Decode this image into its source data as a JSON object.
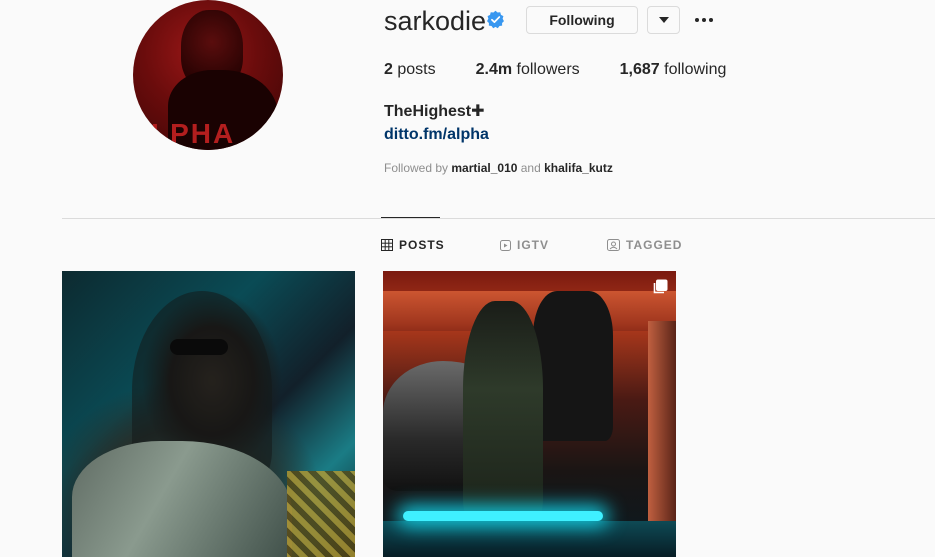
{
  "profile": {
    "username": "sarkodie",
    "verified": true,
    "avatar_text": "LPHA",
    "following_button": "Following",
    "dropdown_icon": "chevron-down-icon",
    "more_icon": "ellipsis-icon",
    "stats": {
      "posts_count": "2",
      "posts_label": " posts",
      "followers_count": "2.4m",
      "followers_label": " followers",
      "following_count": "1,687",
      "following_label": " following"
    },
    "full_name": "TheHighest✚",
    "link": "ditto.fm/alpha",
    "followed_by": {
      "prefix": "Followed by ",
      "user1": "martial_010",
      "joiner": " and ",
      "user2": "khalifa_kutz"
    }
  },
  "tabs": [
    {
      "label": "POSTS",
      "icon": "grid-icon",
      "active": true
    },
    {
      "label": "IGTV",
      "icon": "igtv-icon",
      "active": false
    },
    {
      "label": "TAGGED",
      "icon": "tagged-icon",
      "active": false
    }
  ],
  "posts": [
    {
      "type": "photo"
    },
    {
      "type": "carousel",
      "badge_icon": "multiple-photos-icon"
    }
  ],
  "colors": {
    "background": "#fafafa",
    "text": "#262626",
    "muted": "#8e8e8e",
    "link": "#003569",
    "verified": "#3897f0",
    "border": "#dbdbdb"
  }
}
